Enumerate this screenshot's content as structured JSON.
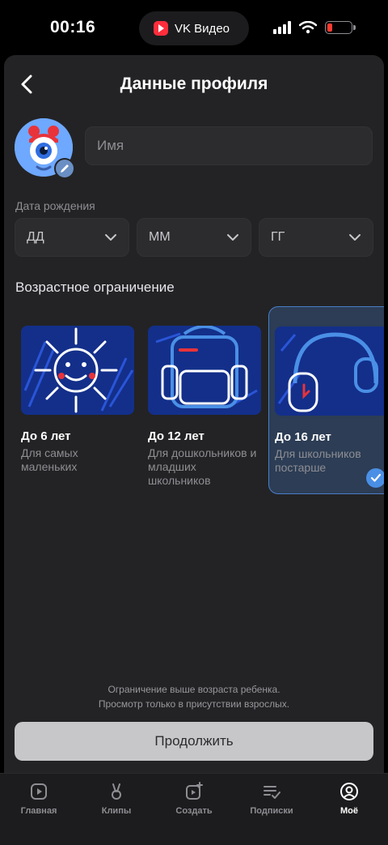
{
  "status_bar": {
    "time": "00:16",
    "app_pill": "VK Видео"
  },
  "header": {
    "title": "Данные профиля"
  },
  "profile": {
    "name_placeholder": "Имя"
  },
  "birth_date": {
    "label": "Дата рождения",
    "day": "ДД",
    "month": "ММ",
    "year": "ГГ"
  },
  "age_restriction": {
    "label": "Возрастное ограничение",
    "options": [
      {
        "title": "До 6 лет",
        "description": "Для самых маленьких",
        "icon": "sun-drawing",
        "selected": false
      },
      {
        "title": "До 12 лет",
        "description": "Для дошкольников и младших школьников",
        "icon": "backpack-drawing",
        "selected": false
      },
      {
        "title": "До 16 лет",
        "description": "Для школьников постарше",
        "icon": "headphones-drawing",
        "selected": true
      }
    ]
  },
  "notice": {
    "line1": "Ограничение выше возраста ребенка.",
    "line2": "Просмотр только в присутствии взрослых."
  },
  "continue_label": "Продолжить",
  "tab_bar": {
    "tabs": [
      {
        "label": "Главная",
        "icon": "video-icon",
        "active": false
      },
      {
        "label": "Клипы",
        "icon": "clips-icon",
        "active": false
      },
      {
        "label": "Создать",
        "icon": "create-icon",
        "active": false
      },
      {
        "label": "Подписки",
        "icon": "subscriptions-icon",
        "active": false
      },
      {
        "label": "Моё",
        "icon": "profile-icon",
        "active": true
      }
    ]
  },
  "colors": {
    "background": "#232325",
    "accent": "#4a8fe6",
    "selected_card": "#2c3d55"
  }
}
